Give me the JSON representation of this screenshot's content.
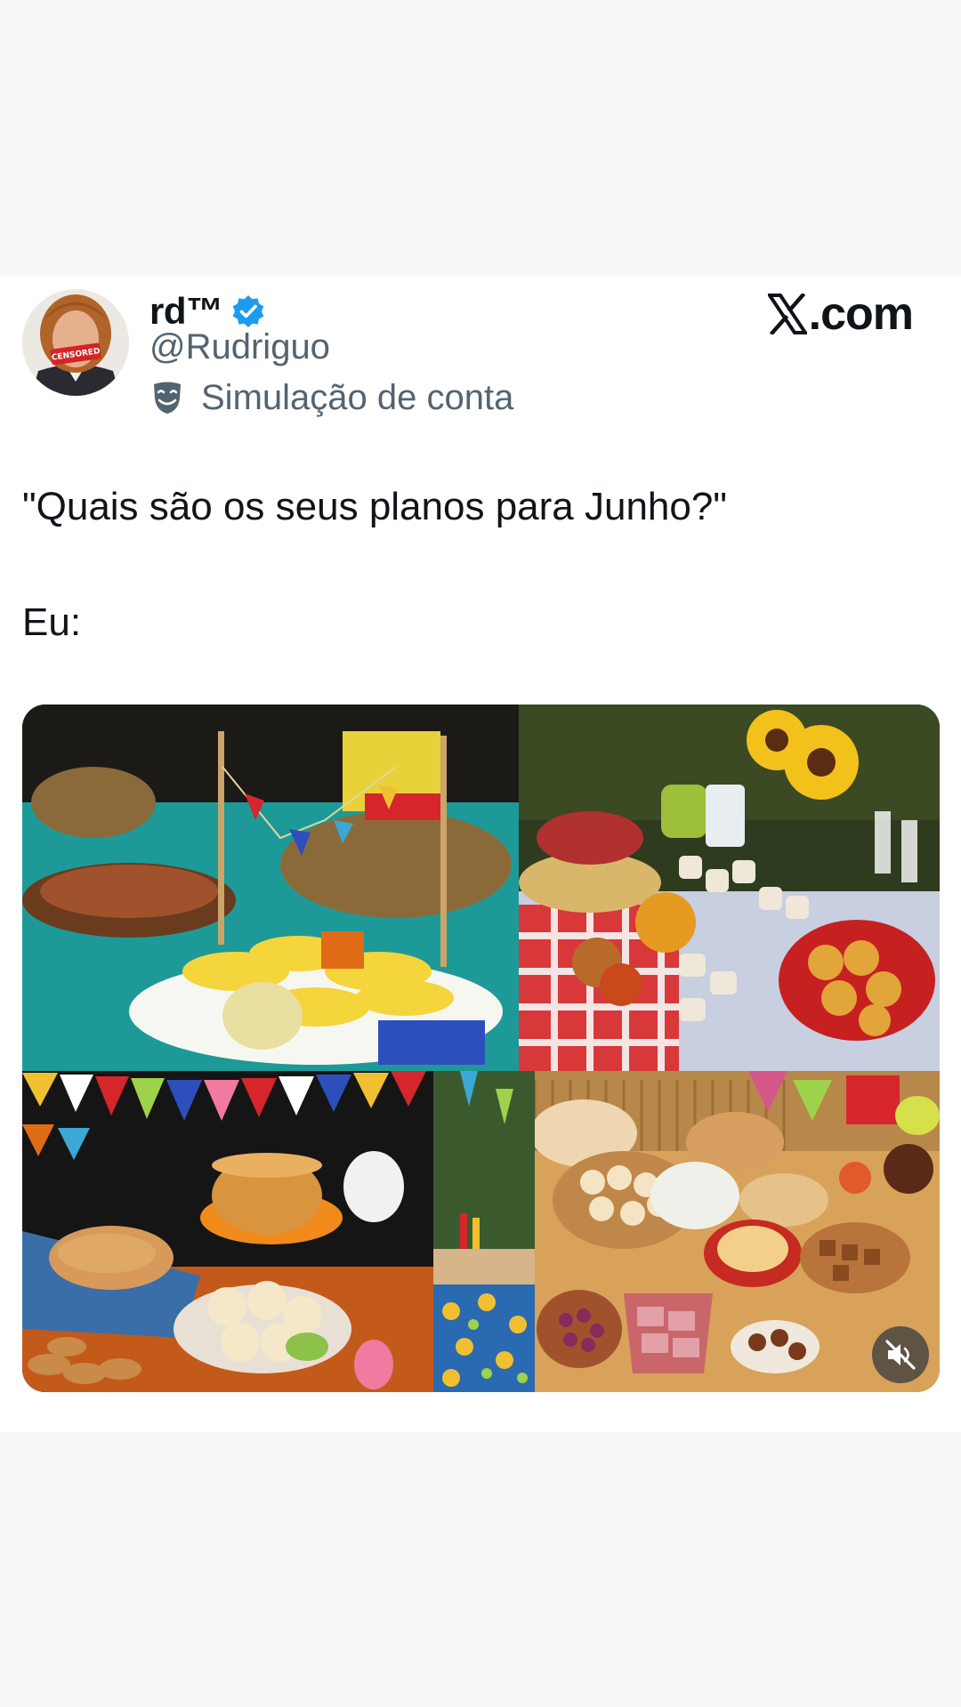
{
  "post": {
    "display_name": "rd™",
    "handle": "@Rudriguo",
    "parody_label": "Simulação de conta",
    "brand": ".com",
    "avatar_badge": "CENSORED",
    "text_line1": "\"Quais são os seus planos para Junho?\"",
    "text_line2": "Eu:"
  },
  "colors": {
    "verified": "#1d9bf0",
    "secondary_text": "#536471",
    "primary_text": "#0f1419",
    "page_background": "#f8f8f7"
  },
  "icons": {
    "verified": "verified-badge-icon",
    "parody": "theater-mask-icon",
    "brand": "x-logo-icon",
    "mute": "speaker-muted-icon"
  },
  "media": {
    "tiles": [
      "corn-table-photo",
      "sunflower-table-photo",
      "cakes-bunting-photo",
      "bunting-strip-photo",
      "sweets-buffet-photo"
    ]
  }
}
